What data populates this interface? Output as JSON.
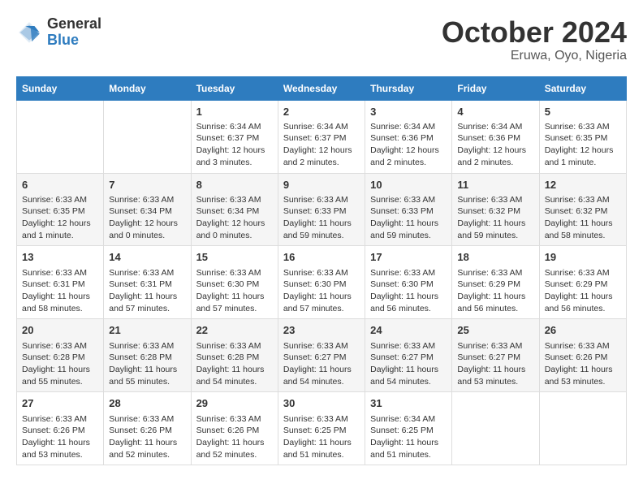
{
  "header": {
    "logo": {
      "line1": "General",
      "line2": "Blue"
    },
    "title": "October 2024",
    "location": "Eruwa, Oyo, Nigeria"
  },
  "weekdays": [
    "Sunday",
    "Monday",
    "Tuesday",
    "Wednesday",
    "Thursday",
    "Friday",
    "Saturday"
  ],
  "weeks": [
    [
      {
        "day": "",
        "info": ""
      },
      {
        "day": "",
        "info": ""
      },
      {
        "day": "1",
        "info": "Sunrise: 6:34 AM\nSunset: 6:37 PM\nDaylight: 12 hours\nand 3 minutes."
      },
      {
        "day": "2",
        "info": "Sunrise: 6:34 AM\nSunset: 6:37 PM\nDaylight: 12 hours\nand 2 minutes."
      },
      {
        "day": "3",
        "info": "Sunrise: 6:34 AM\nSunset: 6:36 PM\nDaylight: 12 hours\nand 2 minutes."
      },
      {
        "day": "4",
        "info": "Sunrise: 6:34 AM\nSunset: 6:36 PM\nDaylight: 12 hours\nand 2 minutes."
      },
      {
        "day": "5",
        "info": "Sunrise: 6:33 AM\nSunset: 6:35 PM\nDaylight: 12 hours\nand 1 minute."
      }
    ],
    [
      {
        "day": "6",
        "info": "Sunrise: 6:33 AM\nSunset: 6:35 PM\nDaylight: 12 hours\nand 1 minute."
      },
      {
        "day": "7",
        "info": "Sunrise: 6:33 AM\nSunset: 6:34 PM\nDaylight: 12 hours\nand 0 minutes."
      },
      {
        "day": "8",
        "info": "Sunrise: 6:33 AM\nSunset: 6:34 PM\nDaylight: 12 hours\nand 0 minutes."
      },
      {
        "day": "9",
        "info": "Sunrise: 6:33 AM\nSunset: 6:33 PM\nDaylight: 11 hours\nand 59 minutes."
      },
      {
        "day": "10",
        "info": "Sunrise: 6:33 AM\nSunset: 6:33 PM\nDaylight: 11 hours\nand 59 minutes."
      },
      {
        "day": "11",
        "info": "Sunrise: 6:33 AM\nSunset: 6:32 PM\nDaylight: 11 hours\nand 59 minutes."
      },
      {
        "day": "12",
        "info": "Sunrise: 6:33 AM\nSunset: 6:32 PM\nDaylight: 11 hours\nand 58 minutes."
      }
    ],
    [
      {
        "day": "13",
        "info": "Sunrise: 6:33 AM\nSunset: 6:31 PM\nDaylight: 11 hours\nand 58 minutes."
      },
      {
        "day": "14",
        "info": "Sunrise: 6:33 AM\nSunset: 6:31 PM\nDaylight: 11 hours\nand 57 minutes."
      },
      {
        "day": "15",
        "info": "Sunrise: 6:33 AM\nSunset: 6:30 PM\nDaylight: 11 hours\nand 57 minutes."
      },
      {
        "day": "16",
        "info": "Sunrise: 6:33 AM\nSunset: 6:30 PM\nDaylight: 11 hours\nand 57 minutes."
      },
      {
        "day": "17",
        "info": "Sunrise: 6:33 AM\nSunset: 6:30 PM\nDaylight: 11 hours\nand 56 minutes."
      },
      {
        "day": "18",
        "info": "Sunrise: 6:33 AM\nSunset: 6:29 PM\nDaylight: 11 hours\nand 56 minutes."
      },
      {
        "day": "19",
        "info": "Sunrise: 6:33 AM\nSunset: 6:29 PM\nDaylight: 11 hours\nand 56 minutes."
      }
    ],
    [
      {
        "day": "20",
        "info": "Sunrise: 6:33 AM\nSunset: 6:28 PM\nDaylight: 11 hours\nand 55 minutes."
      },
      {
        "day": "21",
        "info": "Sunrise: 6:33 AM\nSunset: 6:28 PM\nDaylight: 11 hours\nand 55 minutes."
      },
      {
        "day": "22",
        "info": "Sunrise: 6:33 AM\nSunset: 6:28 PM\nDaylight: 11 hours\nand 54 minutes."
      },
      {
        "day": "23",
        "info": "Sunrise: 6:33 AM\nSunset: 6:27 PM\nDaylight: 11 hours\nand 54 minutes."
      },
      {
        "day": "24",
        "info": "Sunrise: 6:33 AM\nSunset: 6:27 PM\nDaylight: 11 hours\nand 54 minutes."
      },
      {
        "day": "25",
        "info": "Sunrise: 6:33 AM\nSunset: 6:27 PM\nDaylight: 11 hours\nand 53 minutes."
      },
      {
        "day": "26",
        "info": "Sunrise: 6:33 AM\nSunset: 6:26 PM\nDaylight: 11 hours\nand 53 minutes."
      }
    ],
    [
      {
        "day": "27",
        "info": "Sunrise: 6:33 AM\nSunset: 6:26 PM\nDaylight: 11 hours\nand 53 minutes."
      },
      {
        "day": "28",
        "info": "Sunrise: 6:33 AM\nSunset: 6:26 PM\nDaylight: 11 hours\nand 52 minutes."
      },
      {
        "day": "29",
        "info": "Sunrise: 6:33 AM\nSunset: 6:26 PM\nDaylight: 11 hours\nand 52 minutes."
      },
      {
        "day": "30",
        "info": "Sunrise: 6:33 AM\nSunset: 6:25 PM\nDaylight: 11 hours\nand 51 minutes."
      },
      {
        "day": "31",
        "info": "Sunrise: 6:34 AM\nSunset: 6:25 PM\nDaylight: 11 hours\nand 51 minutes."
      },
      {
        "day": "",
        "info": ""
      },
      {
        "day": "",
        "info": ""
      }
    ]
  ]
}
